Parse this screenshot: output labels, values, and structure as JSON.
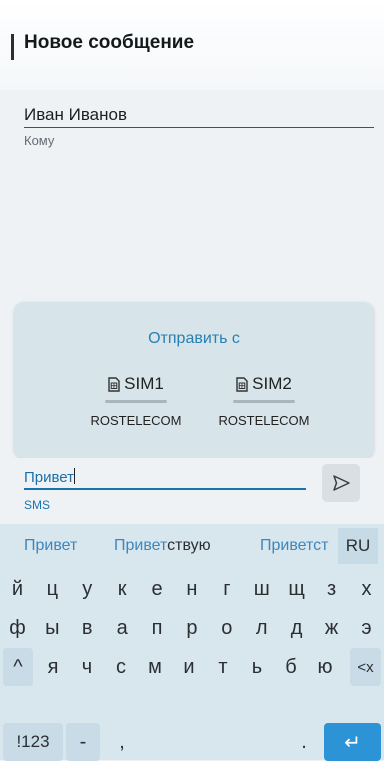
{
  "header": {
    "title": "Новое сообщение"
  },
  "recipient": {
    "name": "Иван Иванов",
    "to_label": "Кому"
  },
  "sim_popup": {
    "title": "Отправить с",
    "sims": [
      {
        "label": "SIM1",
        "operator": "ROSTELECOM"
      },
      {
        "label": "SIM2",
        "operator": "ROSTELECOM"
      }
    ]
  },
  "compose": {
    "text": "Привет",
    "type_label": "SMS"
  },
  "keyboard": {
    "suggestions": {
      "s1": "Привет",
      "s2_prefix": "Привет",
      "s2_rest": "ствую",
      "s3": "Приветст"
    },
    "language": "RU",
    "row1": [
      "й",
      "ц",
      "у",
      "к",
      "е",
      "н",
      "г",
      "ш",
      "щ",
      "з",
      "х"
    ],
    "row2": [
      "ф",
      "ы",
      "в",
      "а",
      "п",
      "р",
      "о",
      "л",
      "д",
      "ж",
      "э"
    ],
    "row3": [
      "я",
      "ч",
      "с",
      "м",
      "и",
      "т",
      "ь",
      "б",
      "ю"
    ],
    "shift": "^",
    "backspace": "<x",
    "sym_label": "!123",
    "dash": "-",
    "comma": ",",
    "period": ".",
    "enter": "↵"
  }
}
